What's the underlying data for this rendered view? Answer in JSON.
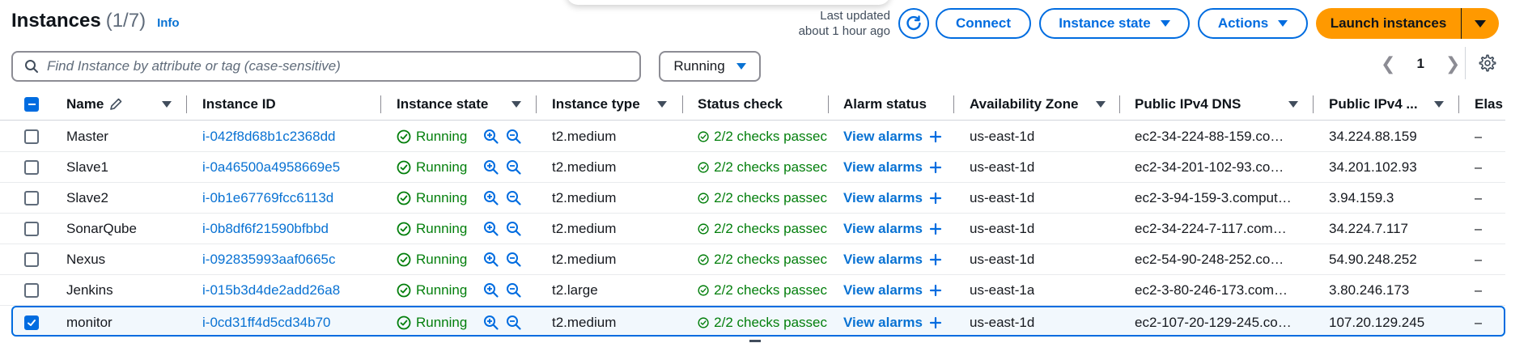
{
  "header": {
    "title": "Instances",
    "count": "(1/7)",
    "info_link": "Info",
    "last_updated_line1": "Last updated",
    "last_updated_line2": "about 1 hour ago",
    "buttons": {
      "connect": "Connect",
      "instance_state": "Instance state",
      "actions": "Actions",
      "launch": "Launch instances"
    }
  },
  "search": {
    "placeholder": "Find Instance by attribute or tag (case-sensitive)",
    "value": ""
  },
  "filter": {
    "selected": "Running"
  },
  "pagination": {
    "current_page": "1"
  },
  "table": {
    "columns": {
      "name": "Name",
      "instance_id": "Instance ID",
      "instance_state": "Instance state",
      "instance_type": "Instance type",
      "status_check": "Status check",
      "alarm_status": "Alarm status",
      "availability_zone": "Availability Zone",
      "public_dns": "Public IPv4 DNS",
      "public_ip": "Public IPv4 ...",
      "elastic": "Elas"
    },
    "rows": [
      {
        "name": "Master",
        "id": "i-042f8d68b1c2368dd",
        "state": "Running",
        "type": "t2.medium",
        "status": "2/2 checks passec",
        "alarm": "View alarms",
        "az": "us-east-1d",
        "dns": "ec2-34-224-88-159.co…",
        "ip": "34.224.88.159",
        "elastic": "–",
        "selected": false
      },
      {
        "name": "Slave1",
        "id": "i-0a46500a4958669e5",
        "state": "Running",
        "type": "t2.medium",
        "status": "2/2 checks passec",
        "alarm": "View alarms",
        "az": "us-east-1d",
        "dns": "ec2-34-201-102-93.co…",
        "ip": "34.201.102.93",
        "elastic": "–",
        "selected": false
      },
      {
        "name": "Slave2",
        "id": "i-0b1e67769fcc6113d",
        "state": "Running",
        "type": "t2.medium",
        "status": "2/2 checks passec",
        "alarm": "View alarms",
        "az": "us-east-1d",
        "dns": "ec2-3-94-159-3.comput…",
        "ip": "3.94.159.3",
        "elastic": "–",
        "selected": false
      },
      {
        "name": "SonarQube",
        "id": "i-0b8df6f21590bfbbd",
        "state": "Running",
        "type": "t2.medium",
        "status": "2/2 checks passec",
        "alarm": "View alarms",
        "az": "us-east-1d",
        "dns": "ec2-34-224-7-117.com…",
        "ip": "34.224.7.117",
        "elastic": "–",
        "selected": false
      },
      {
        "name": "Nexus",
        "id": "i-092835993aaf0665c",
        "state": "Running",
        "type": "t2.medium",
        "status": "2/2 checks passec",
        "alarm": "View alarms",
        "az": "us-east-1d",
        "dns": "ec2-54-90-248-252.co…",
        "ip": "54.90.248.252",
        "elastic": "–",
        "selected": false
      },
      {
        "name": "Jenkins",
        "id": "i-015b3d4de2add26a8",
        "state": "Running",
        "type": "t2.large",
        "status": "2/2 checks passec",
        "alarm": "View alarms",
        "az": "us-east-1a",
        "dns": "ec2-3-80-246-173.com…",
        "ip": "3.80.246.173",
        "elastic": "–",
        "selected": false
      },
      {
        "name": "monitor",
        "id": "i-0cd31ff4d5cd34b70",
        "state": "Running",
        "type": "t2.medium",
        "status": "2/2 checks passec",
        "alarm": "View alarms",
        "az": "us-east-1d",
        "dns": "ec2-107-20-129-245.co…",
        "ip": "107.20.129.245",
        "elastic": "–",
        "selected": true
      }
    ]
  },
  "colors": {
    "link": "#0972d3",
    "primary": "#006ce0",
    "success": "#037f0c",
    "launch_bg": "#ff9900",
    "selected_row_bg": "#f2f8fd"
  },
  "icons": [
    "info-link",
    "refresh-icon",
    "caret-down-icon",
    "search-icon",
    "chevron-left-icon",
    "chevron-right-icon",
    "settings-gear-icon",
    "edit-pencil-icon",
    "sort-icon",
    "check-circle-icon",
    "zoom-in-icon",
    "zoom-out-icon",
    "plus-icon"
  ]
}
